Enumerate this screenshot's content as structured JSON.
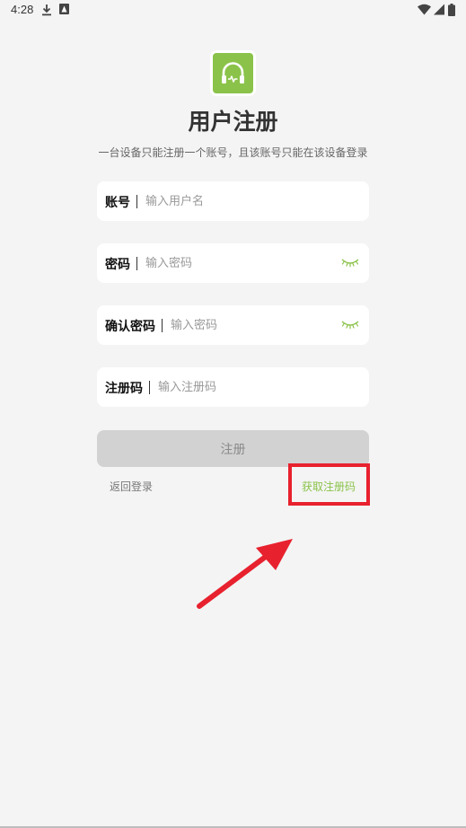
{
  "status_bar": {
    "time": "4:28",
    "icons": [
      "download-icon",
      "app-notification-icon",
      "wifi-icon",
      "signal-icon",
      "battery-icon"
    ]
  },
  "logo": {
    "icon": "headset-icon",
    "color": "#8bc34a"
  },
  "title": "用户注册",
  "subtitle": "一台设备只能注册一个账号，且该账号只能在该设备登录",
  "fields": [
    {
      "label": "账号",
      "placeholder": "输入用户名",
      "value": ""
    },
    {
      "label": "密码",
      "placeholder": "输入密码",
      "value": "",
      "icon": "eye-closed-icon"
    },
    {
      "label": "确认密码",
      "placeholder": "输入密码",
      "value": "",
      "icon": "eye-closed-icon"
    },
    {
      "label": "注册码",
      "placeholder": "输入注册码",
      "value": ""
    }
  ],
  "submit_label": "注册",
  "back_link": "返回登录",
  "get_code_link": "获取注册码",
  "colors": {
    "accent": "#8bc34a",
    "annotation": "#e8212e",
    "background": "#f4f4f4",
    "button_disabled": "#d2d2d2"
  }
}
